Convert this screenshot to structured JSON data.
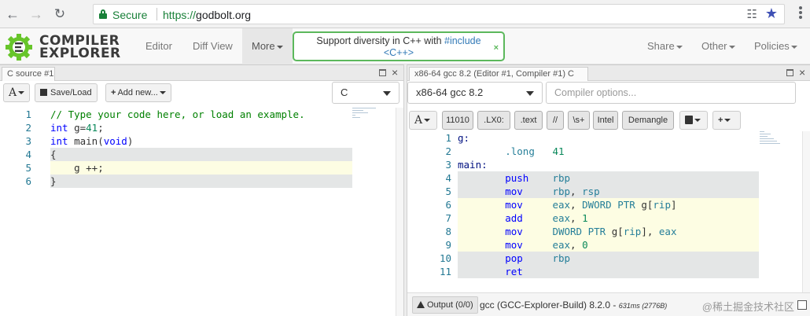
{
  "browser": {
    "secure_label": "Secure",
    "url_scheme": "https://",
    "url_host": "godbolt.org"
  },
  "navbar": {
    "logo_line1": "COMPILER",
    "logo_line2": "EXPLORER",
    "editor": "Editor",
    "diff_view": "Diff View",
    "more": "More",
    "notice_text": "Support diversity in C++ with ",
    "notice_link": "#include",
    "notice_line2": "<C++>",
    "notice_close": "×",
    "share": "Share",
    "other": "Other",
    "policies": "Policies"
  },
  "source_pane": {
    "tab_title": "C source #1",
    "tab_close": "×",
    "font_btn": "A",
    "save_load": "Save/Load",
    "add_new": "Add new...",
    "language": "C",
    "lines": [
      {
        "n": "1",
        "tokens": [
          {
            "c": "cm",
            "t": "// Type your code here, or load an example."
          }
        ]
      },
      {
        "n": "2",
        "tokens": [
          {
            "c": "kw",
            "t": "int"
          },
          {
            "c": "op",
            "t": " g="
          },
          {
            "c": "num",
            "t": "41"
          },
          {
            "c": "op",
            "t": ";"
          }
        ]
      },
      {
        "n": "3",
        "tokens": [
          {
            "c": "kw",
            "t": "int"
          },
          {
            "c": "op",
            "t": " main("
          },
          {
            "c": "kw",
            "t": "void"
          },
          {
            "c": "op",
            "t": ")"
          }
        ]
      },
      {
        "n": "4",
        "tokens": [
          {
            "c": "op",
            "t": "{"
          }
        ]
      },
      {
        "n": "5",
        "tokens": [
          {
            "c": "op",
            "t": "    g ++;"
          }
        ]
      },
      {
        "n": "6",
        "tokens": [
          {
            "c": "op",
            "t": "}"
          }
        ]
      }
    ]
  },
  "compiler_pane": {
    "tab_title": "x86-64 gcc 8.2 (Editor #1, Compiler #1) C",
    "tab_close": "×",
    "compiler": "x86-64 gcc 8.2",
    "options_placeholder": "Compiler options...",
    "font_btn": "A",
    "filters": [
      "11010",
      ".LX0:",
      ".text",
      "//",
      "\\s+",
      "Intel",
      "Demangle"
    ],
    "lines": [
      {
        "n": "1",
        "tokens": [
          {
            "c": "lbl",
            "t": "g:"
          }
        ]
      },
      {
        "n": "2",
        "tokens": [
          {
            "c": "pl",
            "t": "        "
          },
          {
            "c": "reg",
            "t": ".long"
          },
          {
            "c": "pl",
            "t": "   "
          },
          {
            "c": "num",
            "t": "41"
          }
        ]
      },
      {
        "n": "3",
        "tokens": [
          {
            "c": "lbl",
            "t": "main:"
          }
        ]
      },
      {
        "n": "4",
        "tokens": [
          {
            "c": "pl",
            "t": "        "
          },
          {
            "c": "mn",
            "t": "push"
          },
          {
            "c": "pl",
            "t": "    "
          },
          {
            "c": "reg",
            "t": "rbp"
          }
        ]
      },
      {
        "n": "5",
        "tokens": [
          {
            "c": "pl",
            "t": "        "
          },
          {
            "c": "mn",
            "t": "mov"
          },
          {
            "c": "pl",
            "t": "     "
          },
          {
            "c": "reg",
            "t": "rbp"
          },
          {
            "c": "pl",
            "t": ", "
          },
          {
            "c": "reg",
            "t": "rsp"
          }
        ]
      },
      {
        "n": "6",
        "tokens": [
          {
            "c": "pl",
            "t": "        "
          },
          {
            "c": "mn",
            "t": "mov"
          },
          {
            "c": "pl",
            "t": "     "
          },
          {
            "c": "reg",
            "t": "eax"
          },
          {
            "c": "pl",
            "t": ", "
          },
          {
            "c": "reg",
            "t": "DWORD PTR"
          },
          {
            "c": "pl",
            "t": " g["
          },
          {
            "c": "reg",
            "t": "rip"
          },
          {
            "c": "pl",
            "t": "]"
          }
        ]
      },
      {
        "n": "7",
        "tokens": [
          {
            "c": "pl",
            "t": "        "
          },
          {
            "c": "mn",
            "t": "add"
          },
          {
            "c": "pl",
            "t": "     "
          },
          {
            "c": "reg",
            "t": "eax"
          },
          {
            "c": "pl",
            "t": ", "
          },
          {
            "c": "num",
            "t": "1"
          }
        ]
      },
      {
        "n": "8",
        "tokens": [
          {
            "c": "pl",
            "t": "        "
          },
          {
            "c": "mn",
            "t": "mov"
          },
          {
            "c": "pl",
            "t": "     "
          },
          {
            "c": "reg",
            "t": "DWORD PTR"
          },
          {
            "c": "pl",
            "t": " g["
          },
          {
            "c": "reg",
            "t": "rip"
          },
          {
            "c": "pl",
            "t": "], "
          },
          {
            "c": "reg",
            "t": "eax"
          }
        ]
      },
      {
        "n": "9",
        "tokens": [
          {
            "c": "pl",
            "t": "        "
          },
          {
            "c": "mn",
            "t": "mov"
          },
          {
            "c": "pl",
            "t": "     "
          },
          {
            "c": "reg",
            "t": "eax"
          },
          {
            "c": "pl",
            "t": ", "
          },
          {
            "c": "num",
            "t": "0"
          }
        ]
      },
      {
        "n": "10",
        "tokens": [
          {
            "c": "pl",
            "t": "        "
          },
          {
            "c": "mn",
            "t": "pop"
          },
          {
            "c": "pl",
            "t": "     "
          },
          {
            "c": "reg",
            "t": "rbp"
          }
        ]
      },
      {
        "n": "11",
        "tokens": [
          {
            "c": "pl",
            "t": "        "
          },
          {
            "c": "mn",
            "t": "ret"
          }
        ]
      }
    ],
    "output_label": "Output",
    "output_count": "(0/0)",
    "compiler_info": "gcc (GCC-Explorer-Build) 8.2.0 - ",
    "compile_time": "631ms (2776B)",
    "watermark": "@稀土掘金技术社区"
  },
  "colors": {
    "highlight_grey": "#e4e6e6",
    "highlight_yellow": "#fdfde3",
    "accent_green": "#5cb85c"
  }
}
